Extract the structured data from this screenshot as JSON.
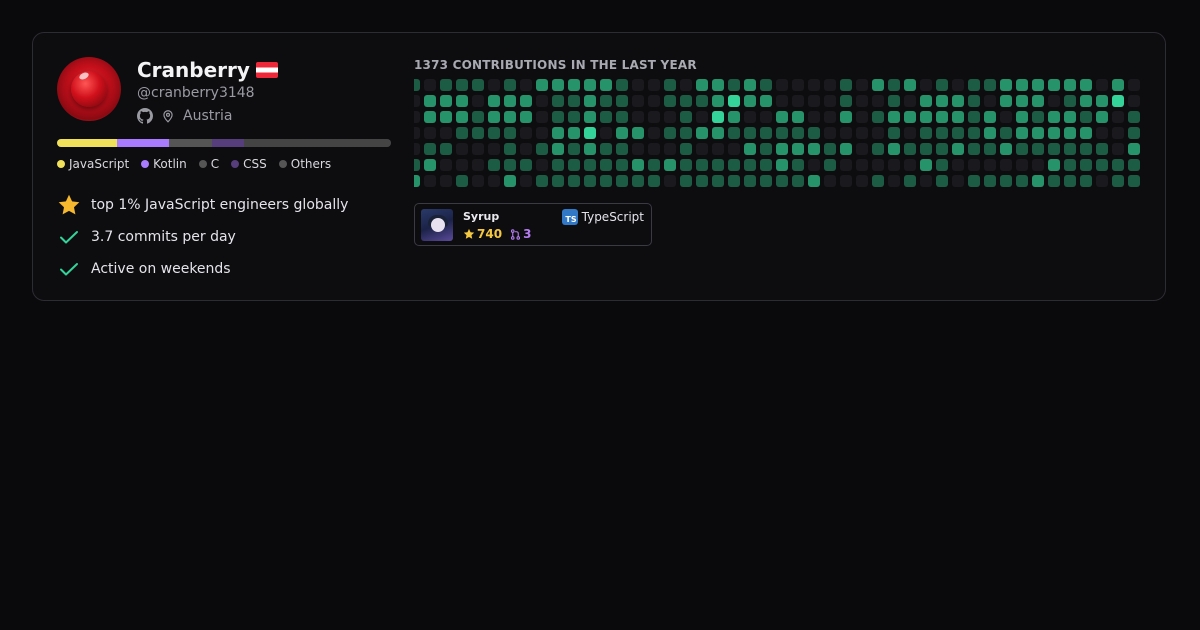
{
  "profile": {
    "name": "Cranberry",
    "flag": "Austria flag",
    "username": "@cranberry3148",
    "location": "Austria"
  },
  "languages": [
    {
      "name": "JavaScript",
      "color": "#f1e05a",
      "share": 0.18
    },
    {
      "name": "Kotlin",
      "color": "#a97bff",
      "share": 0.155
    },
    {
      "name": "C",
      "color": "#555555",
      "share": 0.13
    },
    {
      "name": "CSS",
      "color": "#563d7c",
      "share": 0.095
    },
    {
      "name": "Others",
      "color": "#444444",
      "share": 0.44
    }
  ],
  "highlights": [
    {
      "icon": "star-icon",
      "text": "top 1% JavaScript engineers globally"
    },
    {
      "icon": "check-icon",
      "text": "3.7 commits per day"
    },
    {
      "icon": "check-icon",
      "text": "Active on weekends"
    }
  ],
  "contributions": {
    "title": "1373 CONTRIBUTIONS IN THE LAST YEAR",
    "palette": [
      "#1a1a1e",
      "#1d5c44",
      "#27936a",
      "#34d399"
    ],
    "weeks": 46,
    "levels": [
      "1011101022222100102212100001021201011222222020",
      "0222022201121100111232200001001022210222012230",
      "0222122201121100010320022002012222212021221201",
      "0001111002230220112211111100001011112122222001",
      "0110001012121100010002122212012111211211111102",
      "1200011101111121211111121010000021000000211111",
      "2001002011111111011111111200010101011112111011"
    ]
  },
  "repo": {
    "name": "Syrup",
    "stars": "740",
    "prs": "3",
    "language": "TypeScript",
    "language_badge": "TS"
  }
}
